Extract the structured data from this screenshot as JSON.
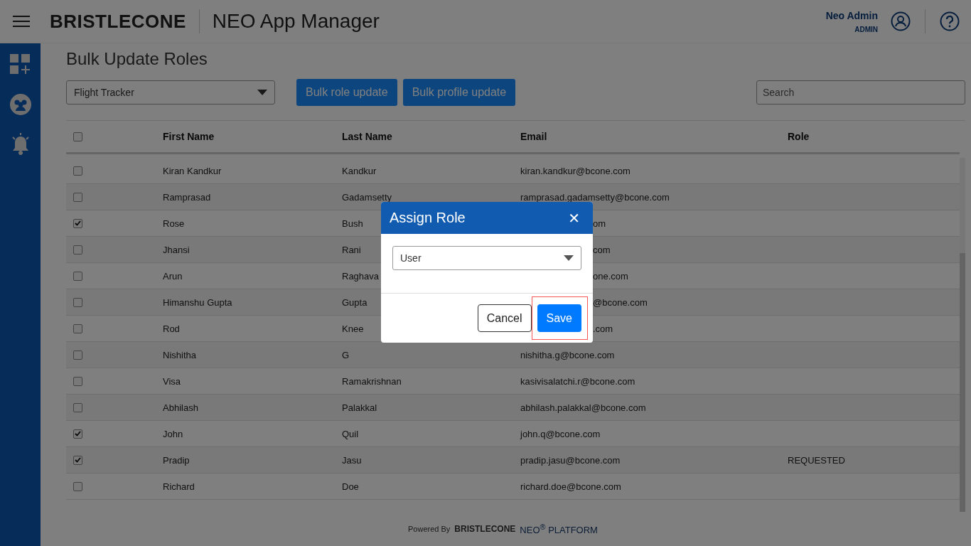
{
  "header": {
    "logo": "BRISTLECONE",
    "title": "NEO App Manager",
    "user_name": "Neo Admin",
    "user_role": "ADMIN"
  },
  "page_title": "Bulk Update Roles",
  "app_select": {
    "value": "Flight Tracker"
  },
  "buttons": [
    "Bulk role update",
    "Bulk profile update"
  ],
  "search": {
    "placeholder": "Search"
  },
  "table": {
    "select_all_checked": false,
    "columns": [
      "First Name",
      "Last Name",
      "Email",
      "Role"
    ],
    "rows": [
      {
        "checked": false,
        "first": "Kiran Kandkur",
        "last": "Kandkur",
        "email": "kiran.kandkur@bcone.com"
      },
      {
        "checked": false,
        "first": "Ramprasad",
        "last": "Gadamsetty",
        "email": "ramprasad.gadamsetty@bcone.com"
      },
      {
        "checked": true,
        "first": "Rose",
        "last": "Bush",
        "email": "om",
        "covered": true
      },
      {
        "checked": false,
        "first": "Jhansi",
        "last": "Rani",
        "email": "com",
        "covered": true
      },
      {
        "checked": false,
        "first": "Arun",
        "last": "Raghava",
        "email": "one.com",
        "covered": true
      },
      {
        "checked": false,
        "first": "Himanshu Gupta",
        "last": "Gupta",
        "email": "@bcone.com",
        "covered": true
      },
      {
        "checked": false,
        "first": "Rod",
        "last": "Knee",
        "email": ".com",
        "covered": true
      },
      {
        "checked": false,
        "first": "Nishitha",
        "last": "G",
        "email": "nishitha.g@bcone.com"
      },
      {
        "checked": false,
        "first": "Visa",
        "last": "Ramakrishnan",
        "email": "kasivisalatchi.r@bcone.com"
      },
      {
        "checked": false,
        "first": "Abhilash",
        "last": "Palakkal",
        "email": "abhilash.palakkal@bcone.com"
      },
      {
        "checked": true,
        "first": "John",
        "last": "Quil",
        "email": "john.q@bcone.com"
      },
      {
        "checked": true,
        "first": "Pradip",
        "last": "Jasu",
        "email": "pradip.jasu@bcone.com",
        "role": "REQUESTED"
      },
      {
        "checked": false,
        "first": "Richard",
        "last": "Doe",
        "email": "richard.doe@bcone.com"
      }
    ]
  },
  "footer": {
    "powered_by": "Powered By",
    "logo": "BRISTLECONE",
    "platform": "NEO$^{®}$ PLATFORM"
  },
  "dialog": {
    "title": "Assign Role",
    "close": "✕",
    "role_select": {
      "value": "User"
    },
    "cancel": "Cancel",
    "save": "Save",
    "save_highlighted": true
  }
}
